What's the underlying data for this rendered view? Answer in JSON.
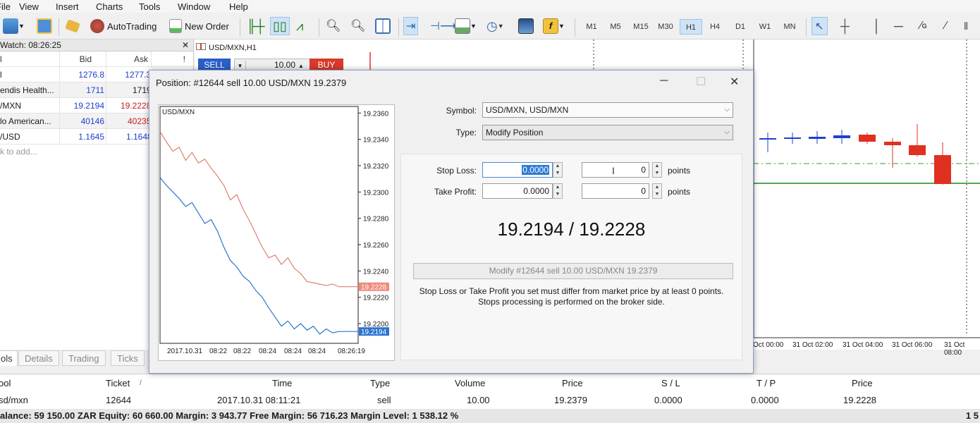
{
  "menu": [
    "File",
    "View",
    "Insert",
    "Charts",
    "Tools",
    "Window",
    "Help"
  ],
  "toolbar": {
    "autotrading": "AutoTrading",
    "new_order": "New Order",
    "timeframes": [
      "M1",
      "M5",
      "M15",
      "M30",
      "H1",
      "H4",
      "D1",
      "W1",
      "MN"
    ],
    "active_timeframe": "H1"
  },
  "market_watch": {
    "title": "Watch: 08:26:25",
    "headers": {
      "symbol": "l",
      "bid": "Bid",
      "ask": "Ask",
      "extra": "!"
    },
    "rows": [
      {
        "symbol": "l",
        "bid": "1276.8",
        "ask": "1277.3"
      },
      {
        "symbol": "endis Health...",
        "bid": "1711",
        "ask": "1719"
      },
      {
        "symbol": "/MXN",
        "bid": "19.2194",
        "ask": "19.2228"
      },
      {
        "symbol": "lo American...",
        "bid": "40146",
        "ask": "40235"
      },
      {
        "symbol": "/USD",
        "bid": "1.1645",
        "ask": "1.1648"
      }
    ],
    "add": "k to add..."
  },
  "chart": {
    "title": "USD/MXN,H1",
    "sell": "SELL",
    "buy": "BUY",
    "volume": "10.00",
    "time_labels": [
      "Oct 00:00",
      "31 Oct 02:00",
      "31 Oct 04:00",
      "31 Oct 06:00",
      "31 Oct 08:00"
    ]
  },
  "tabs": [
    "ols",
    "Details",
    "Trading",
    "Ticks"
  ],
  "orders": {
    "headers": {
      "symbol": "ool",
      "ticket": "Ticket",
      "sort": "/",
      "time": "Time",
      "type": "Type",
      "volume": "Volume",
      "price": "Price",
      "sl": "S / L",
      "tp": "T / P",
      "price2": "Price"
    },
    "row": {
      "symbol": "sd/mxn",
      "ticket": "12644",
      "time": "2017.10.31 08:11:21",
      "type": "sell",
      "volume": "10.00",
      "price": "19.2379",
      "sl": "0.0000",
      "tp": "0.0000",
      "price2": "19.2228"
    }
  },
  "status": "alance: 59 150.00 ZAR  Equity: 60 660.00  Margin: 3 943.77  Free Margin: 56 716.23  Margin Level: 1 538.12 %",
  "status_right": "1 5",
  "dialog": {
    "title": "Position: #12644 sell 10.00 USD/MXN 19.2379",
    "symbol_label": "Symbol:",
    "symbol_value": "USD/MXN, USD/MXN",
    "type_label": "Type:",
    "type_value": "Modify Position",
    "sl_label": "Stop Loss:",
    "sl_value": "0.0000",
    "sl_points": "0",
    "tp_label": "Take Profit:",
    "tp_value": "0.0000",
    "tp_points": "0",
    "points": "points",
    "quote": "19.2194 / 19.2228",
    "modify_button": "Modify #12644 sell 10.00 USD/MXN 19.2379",
    "note1": "Stop Loss or Take Profit you set must differ from market price by at least 0 points.",
    "note2": "Stops processing is performed on the broker side."
  },
  "chart_data": {
    "type": "line",
    "title": "USD/MXN",
    "y_ticks": [
      "19.2360",
      "19.2340",
      "19.2320",
      "19.2300",
      "19.2280",
      "19.2260",
      "19.2240",
      "19.2220",
      "19.2200"
    ],
    "x_ticks": [
      "2017.10.31",
      "08:22",
      "08:22",
      "08:24",
      "08:24",
      "08:24",
      "08:26:19"
    ],
    "ylim": [
      19.2185,
      19.2365
    ],
    "series": [
      {
        "color": "#e08070",
        "values": [
          19.2346,
          19.2338,
          19.2331,
          19.2334,
          19.2324,
          19.233,
          19.2322,
          19.2325,
          19.2318,
          19.2312,
          19.2305,
          19.2294,
          19.2298,
          19.2287,
          19.2278,
          19.2268,
          19.2258,
          19.225,
          19.2252,
          19.2245,
          19.225,
          19.2242,
          19.2238,
          19.2232,
          19.2231,
          19.223,
          19.2229,
          19.223,
          19.2228,
          19.2228,
          19.2228,
          19.2228
        ]
      },
      {
        "color": "#2c74d1",
        "values": [
          19.2311,
          19.2305,
          19.23,
          19.2295,
          19.2289,
          19.2292,
          19.2284,
          19.2276,
          19.2279,
          19.227,
          19.2258,
          19.2248,
          19.2243,
          19.2236,
          19.2232,
          19.2225,
          19.222,
          19.2212,
          19.2205,
          19.2198,
          19.2202,
          19.2196,
          19.22,
          19.2195,
          19.2198,
          19.2192,
          19.2196,
          19.2193,
          19.2194,
          19.2194,
          19.2194,
          19.2194
        ]
      }
    ],
    "price_labels": [
      {
        "value": "19.2228",
        "color": "#f08a7a"
      },
      {
        "value": "19.2194",
        "color": "#2c74d1"
      }
    ]
  }
}
